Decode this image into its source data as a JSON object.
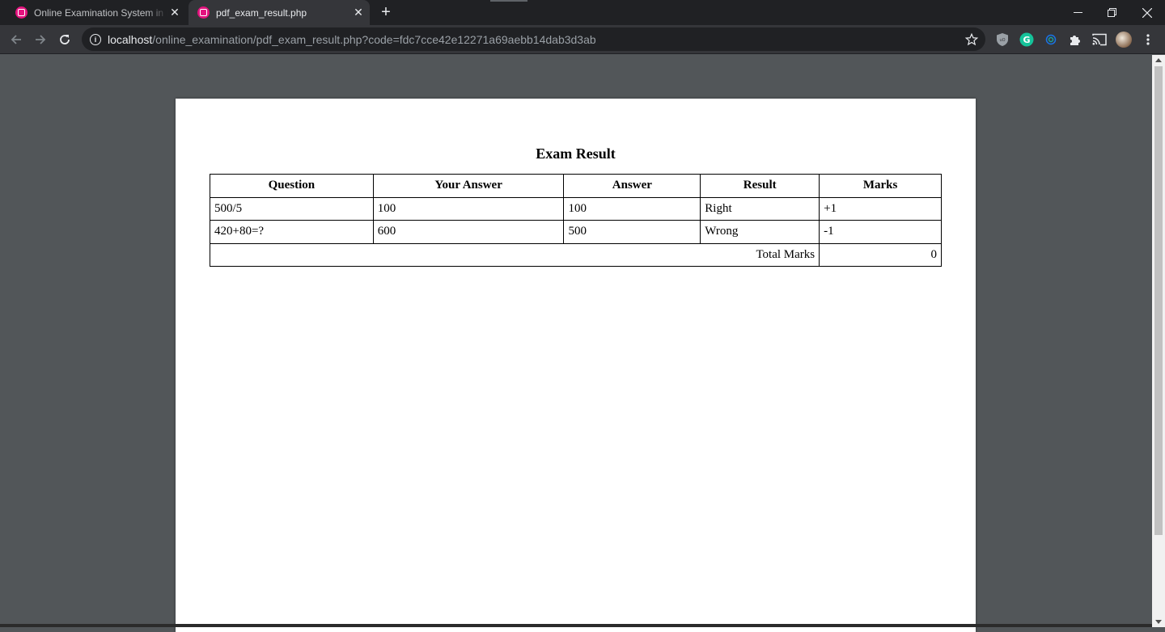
{
  "browser": {
    "tabs": [
      {
        "title": "Online Examination System in PHP",
        "active": false
      },
      {
        "title": "pdf_exam_result.php",
        "active": true
      }
    ],
    "address": {
      "host": "localhost",
      "path": "/online_examination/pdf_exam_result.php?code=fdc7cce42e12271a69aebb14dab3d3ab"
    },
    "colors": {
      "favicon": "#e3127e",
      "tabstrip": "#202124",
      "toolbar": "#35363a",
      "viewer_bg": "#525659"
    }
  },
  "document": {
    "title": "Exam Result",
    "headers": [
      "Question",
      "Your Answer",
      "Answer",
      "Result",
      "Marks"
    ],
    "rows": [
      {
        "question": "500/5",
        "your_answer": "100",
        "answer": "100",
        "result": "Right",
        "marks": "+1"
      },
      {
        "question": "420+80=?",
        "your_answer": "600",
        "answer": "500",
        "result": "Wrong",
        "marks": "-1"
      }
    ],
    "total_label": "Total Marks",
    "total_value": "0"
  }
}
